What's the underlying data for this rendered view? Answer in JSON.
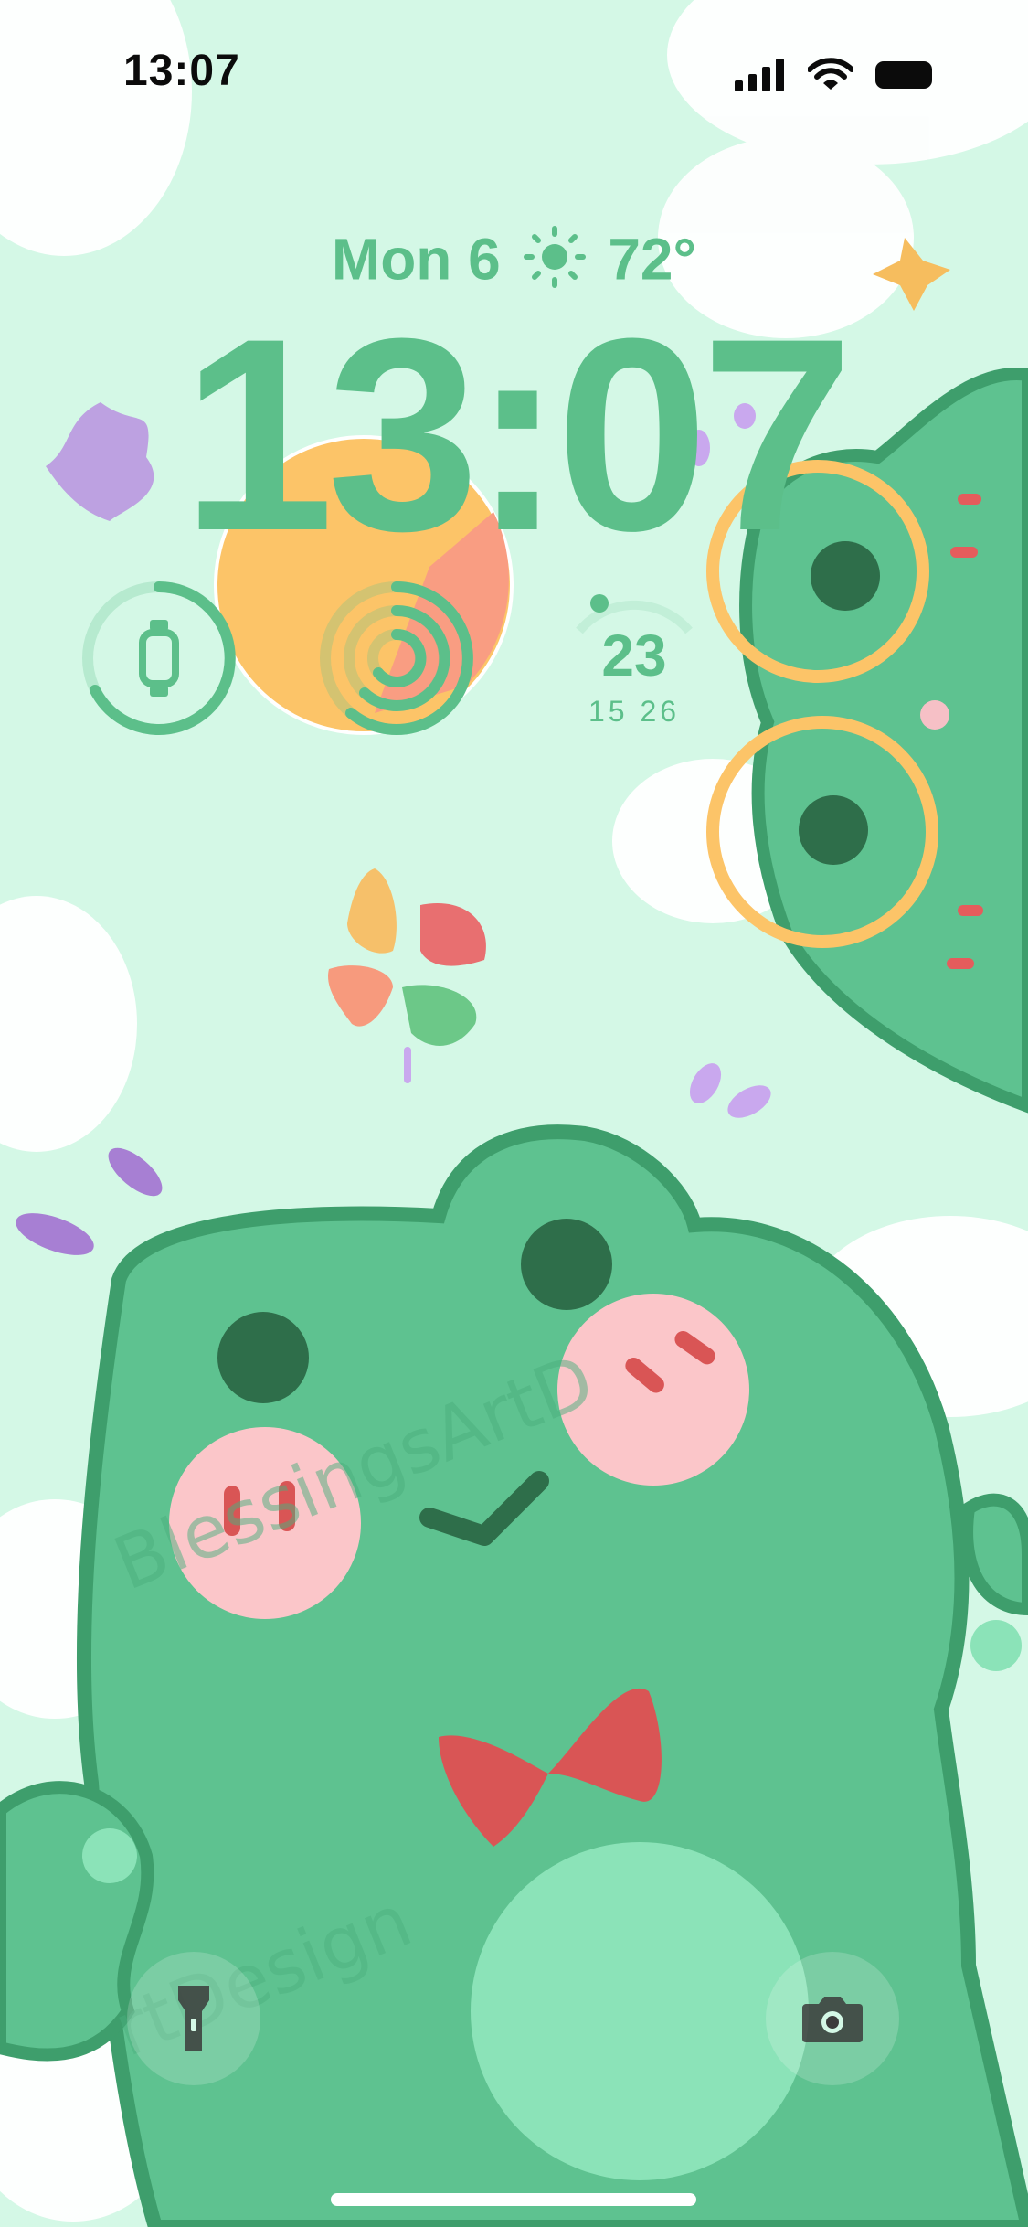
{
  "status_bar": {
    "time": "13:07",
    "icons": [
      "cellular-signal-icon",
      "wifi-icon",
      "battery-icon"
    ]
  },
  "lock_screen": {
    "date_text": "Mon 6",
    "temperature": "72°",
    "weather_icon": "sun-icon",
    "time": "13:07"
  },
  "widgets": {
    "watch_battery_icon": "watch-icon",
    "activity_icon": "activity-rings-icon",
    "calendar": {
      "day": "23",
      "range_low": "15",
      "range_high": "26"
    }
  },
  "quick_actions": {
    "left_icon": "flashlight-icon",
    "right_icon": "camera-icon"
  },
  "colors": {
    "accent": "#5cbf8a",
    "background": "#d4f8e6",
    "frog_body": "#5ec290",
    "frog_outline": "#3e9e6c"
  },
  "watermark": "BlessingsArtDesign"
}
